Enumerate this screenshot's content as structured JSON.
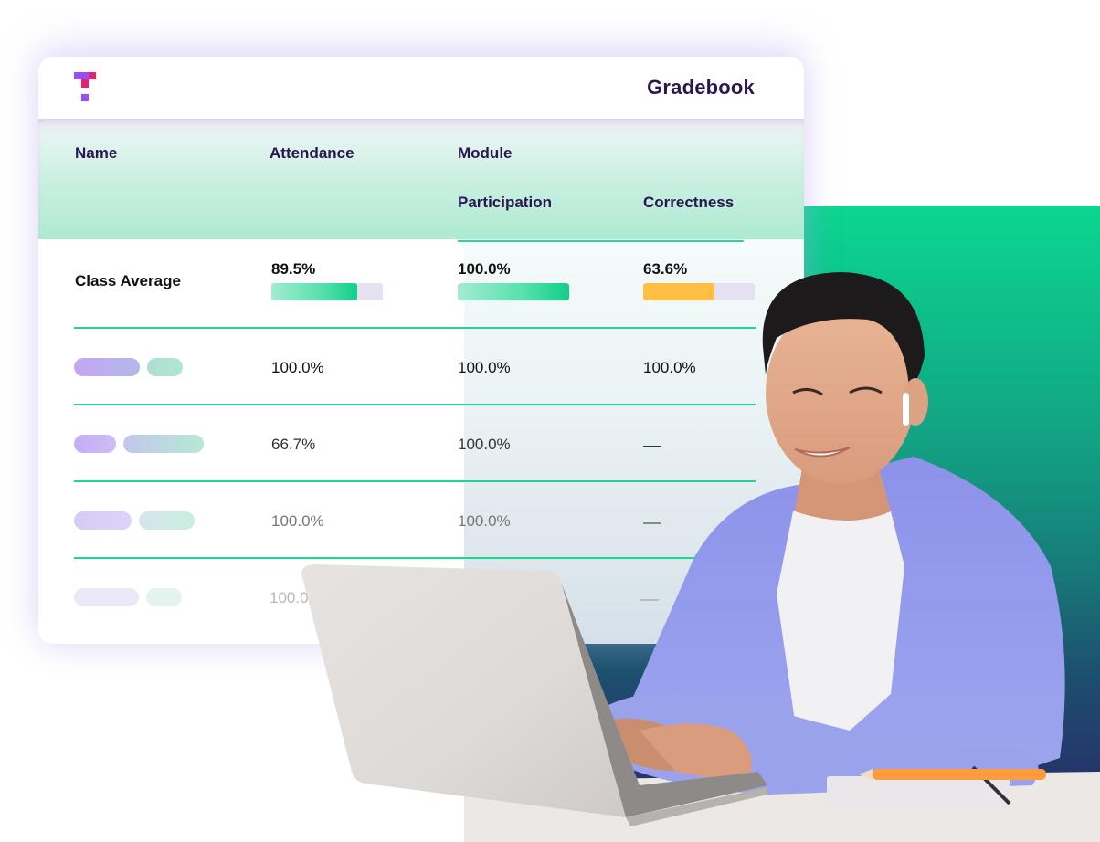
{
  "app": {
    "title": "Gradebook",
    "logo": "t-logo-icon"
  },
  "table": {
    "headers": {
      "name": "Name",
      "attendance": "Attendance",
      "module": "Module",
      "participation": "Participation",
      "correctness": "Correctness"
    },
    "class_average": {
      "label": "Class Average",
      "attendance": {
        "text": "89.5%",
        "value": 89.5
      },
      "participation": {
        "text": "100.0%",
        "value": 100.0
      },
      "correctness": {
        "text": "63.6%",
        "value": 63.6
      }
    },
    "rows": [
      {
        "name": "redacted-name",
        "attendance": "100.0%",
        "participation": "100.0%",
        "correctness": "100.0%"
      },
      {
        "name": "redacted-name",
        "attendance": "66.7%",
        "participation": "100.0%",
        "correctness": "—"
      },
      {
        "name": "redacted-name",
        "attendance": "100.0%",
        "participation": "100.0%",
        "correctness": "—"
      },
      {
        "name": "redacted-name",
        "attendance": "100.0%",
        "participation": "",
        "correctness": "—"
      }
    ]
  },
  "colors": {
    "brand_navy": "#2a1650",
    "accent_green": "#10cf88",
    "warning_yellow": "#ffbf45",
    "logo_purple": "#9a4ef6",
    "logo_pink": "#e8206e"
  },
  "image": {
    "subject": "smiling man with earbuds typing on laptop"
  }
}
